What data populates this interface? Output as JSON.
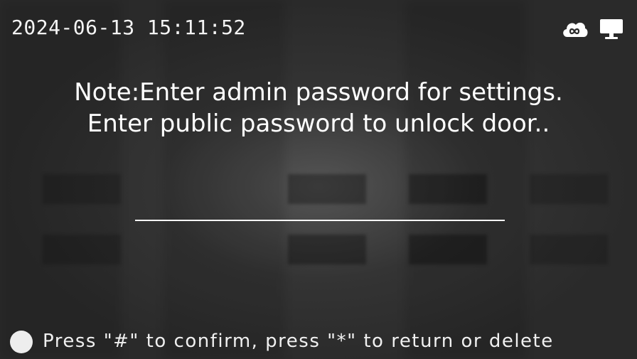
{
  "status": {
    "datetime": "2024-06-13  15:11:52",
    "icons": [
      "cloud-link-icon",
      "monitor-icon"
    ]
  },
  "note": {
    "line1": "Note:Enter admin password for settings.",
    "line2": "Enter public password to unlock door.."
  },
  "password": {
    "value": ""
  },
  "hint": {
    "text": "Press \"#\" to confirm, press \"*\" to return or delete"
  },
  "colors": {
    "background": "#2a2a2a",
    "text": "#ffffff",
    "accent": "#eeeeee"
  }
}
